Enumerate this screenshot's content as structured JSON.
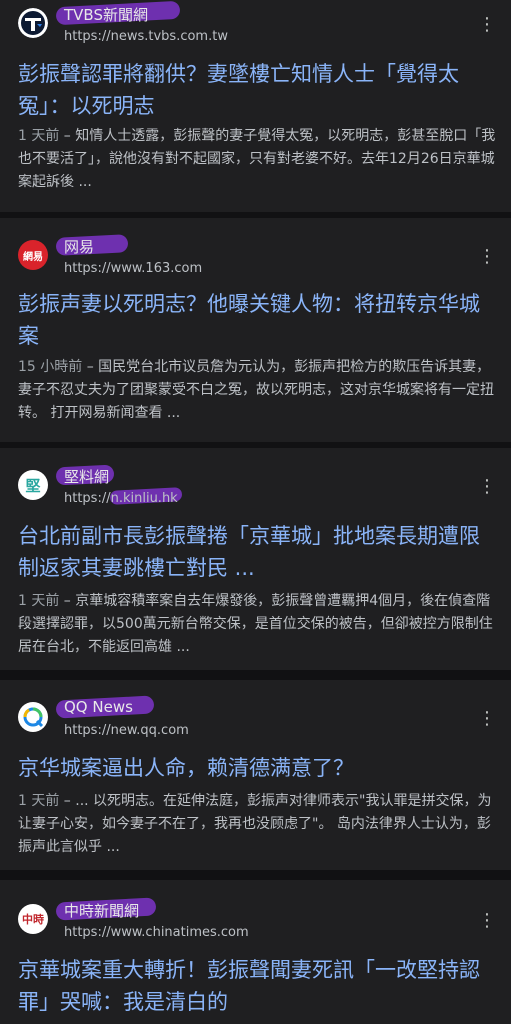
{
  "results": [
    {
      "source": "TVBS新聞網",
      "url": "https://news.tvbs.com.tw",
      "title": "彭振聲認罪將翻供？妻墜樓亡知情人士「覺得太冤」：以死明志",
      "time": "1 天前",
      "snippet": " – 知情人士透露，彭振聲的妻子覺得太冤，以死明志，彭甚至脫口「我也不要活了」，說他沒有對不起國家，只有對老婆不好。去年12月26日京華城案起訴後 ...",
      "logo_text": "T",
      "logo_color": "#0d1a33"
    },
    {
      "source": "网易",
      "url": "https://www.163.com",
      "title": "彭振声妻以死明志？他曝关键人物：将扭转京华城案",
      "time": "15 小時前",
      "snippet": " – 国民党台北市议员詹为元认为，彭振声把检方的欺压告诉其妻，妻子不忍丈夫为了团聚蒙受不白之冤，故以死明志，这对京华城案将有一定扭转。 打开网易新闻查看 ...",
      "logo_text": "網易",
      "logo_color": "#d9232b"
    },
    {
      "source": "堅料網",
      "url": "https://n.kinliu.hk",
      "title": "台北前副市長彭振聲捲「京華城」批地案長期遭限制返家其妻跳樓亡對民 ...",
      "time": "1 天前",
      "snippet": " – 京華城容積率案自去年爆發後，彭振聲曾遭羈押4個月，後在偵查階段選擇認罪，以500萬元新台幣交保，是首位交保的被告，但卻被控方限制住居在台北，不能返回高雄 ...",
      "logo_text": "堅",
      "logo_color": "#ffffff"
    },
    {
      "source": "QQ News",
      "url": "https://new.qq.com",
      "title": "京华城案逼出人命，赖清德满意了？",
      "time": "1 天前",
      "snippet": " – ... 以死明志。在延伸法庭，彭振声对律师表示\"我认罪是拼交保，为让妻子心安，如今妻子不在了，我再也没顾虑了\"。 岛内法律界人士认为，彭振声此言似乎 ...",
      "logo_text": "Q",
      "logo_color": "#ffffff"
    },
    {
      "source": "中時新聞網",
      "url": "https://www.chinatimes.com",
      "title": "京華城案重大轉折！彭振聲聞妻死訊「一改堅持認罪」哭喊：我是清白的",
      "time": "",
      "snippet": "",
      "logo_text": "中時",
      "logo_color": "#ffffff"
    }
  ],
  "menu_icon": "⋮"
}
